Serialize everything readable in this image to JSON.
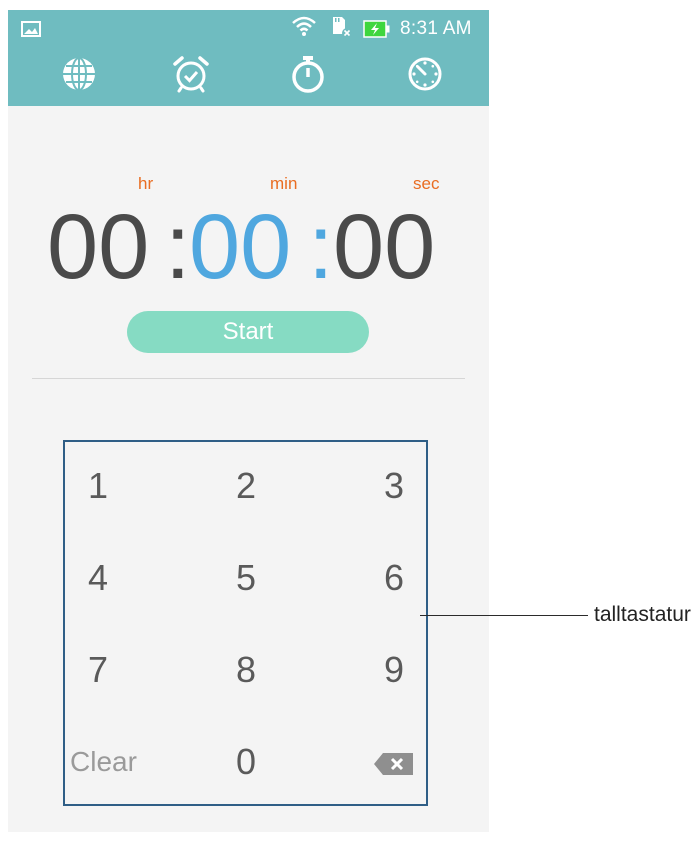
{
  "status_bar": {
    "time": "8:31 AM",
    "icons": [
      "gallery-notification-icon",
      "wifi-icon",
      "sd-card-icon",
      "battery-charging-icon"
    ]
  },
  "tabs": [
    {
      "name": "world-clock",
      "icon": "globe-icon"
    },
    {
      "name": "alarm",
      "icon": "alarm-clock-icon"
    },
    {
      "name": "stopwatch",
      "icon": "stopwatch-icon"
    },
    {
      "name": "timer",
      "icon": "timer-icon",
      "selected": true
    }
  ],
  "timer": {
    "units": {
      "hr": "hr",
      "min": "min",
      "sec": "sec"
    },
    "hours": "00",
    "minutes": "00",
    "seconds": "00",
    "separator": ":",
    "start_label": "Start"
  },
  "keypad": {
    "keys": [
      "1",
      "2",
      "3",
      "4",
      "5",
      "6",
      "7",
      "8",
      "9",
      "Clear",
      "0"
    ],
    "backspace_icon": "backspace-icon"
  },
  "annotation": {
    "label": "talltastatur"
  },
  "colors": {
    "app_bar": "#6fbcc0",
    "unit_labels": "#e96d22",
    "active_digits": "#4fa7df",
    "start_button": "#86dbc3",
    "keypad_frame": "#2f5e86"
  }
}
